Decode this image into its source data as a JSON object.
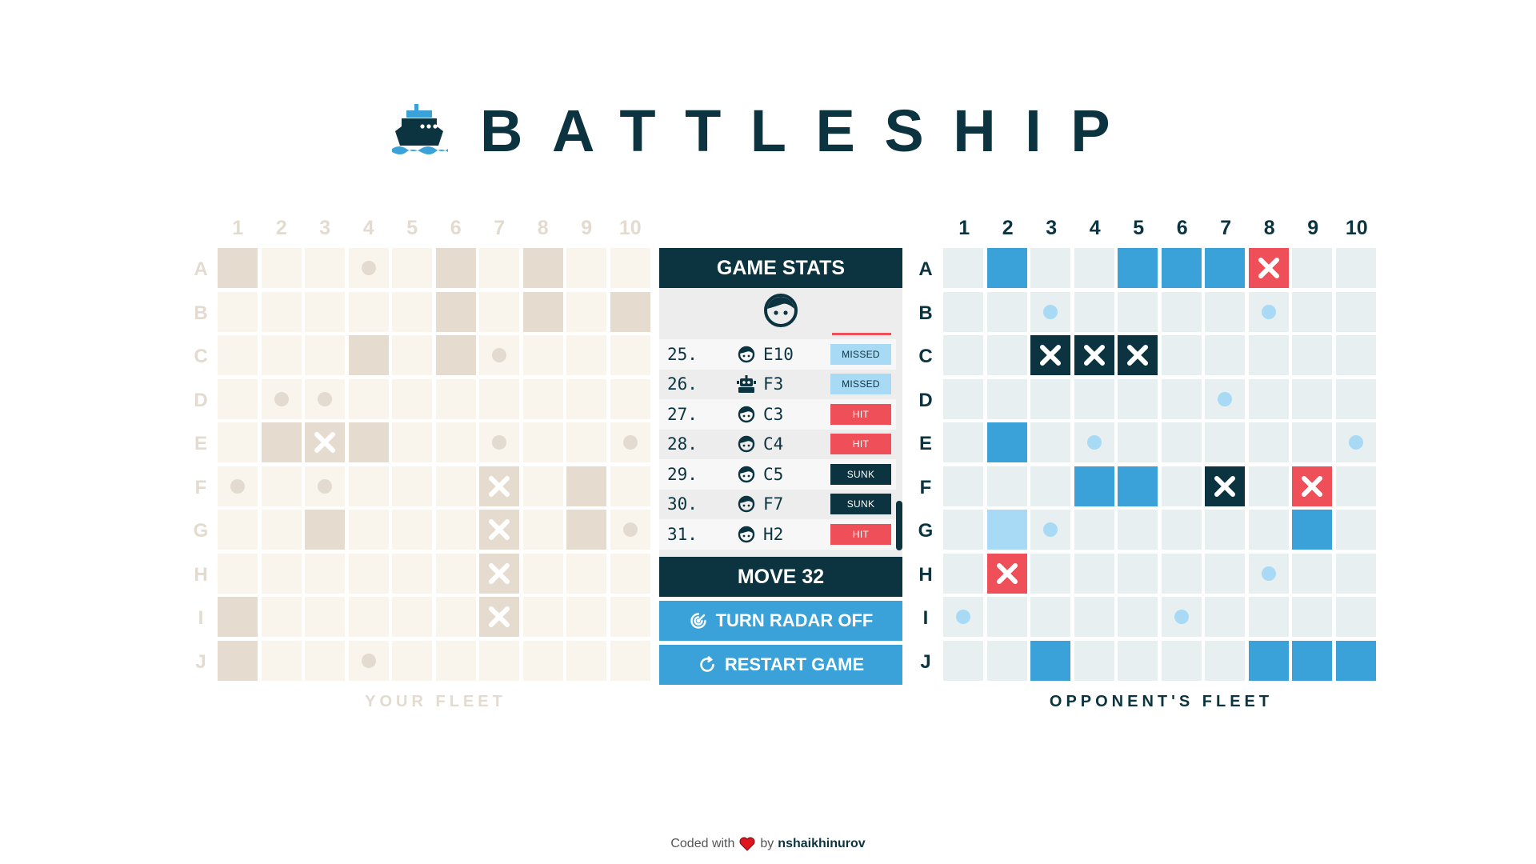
{
  "header": {
    "title": "BATTLESHIP",
    "logo_icon": "ship-icon"
  },
  "columns": [
    "1",
    "2",
    "3",
    "4",
    "5",
    "6",
    "7",
    "8",
    "9",
    "10"
  ],
  "rows": [
    "A",
    "B",
    "C",
    "D",
    "E",
    "F",
    "G",
    "H",
    "I",
    "J"
  ],
  "player_board": {
    "caption": "YOUR FLEET",
    "ship_cells": [
      "A1",
      "A6",
      "A8",
      "B6",
      "B8",
      "B10",
      "C4",
      "C6",
      "E2",
      "E3",
      "E4",
      "F9",
      "G3",
      "G9",
      "I1",
      "J1",
      "F7",
      "G7",
      "H7",
      "I7"
    ],
    "hit_cells": [
      "E3",
      "F7",
      "G7",
      "H7",
      "I7"
    ],
    "miss_cells": [
      "A4",
      "C7",
      "D2",
      "D3",
      "E7",
      "E10",
      "F1",
      "F3",
      "G10",
      "J4"
    ]
  },
  "opponent_board": {
    "caption": "OPPONENT'S FLEET",
    "ship_cells": [
      "A2",
      "A5",
      "A6",
      "A7",
      "E2",
      "F4",
      "F5",
      "G9",
      "J3",
      "J8",
      "J9",
      "J10"
    ],
    "ship_light_cells": [
      "G2"
    ],
    "hit_cells": [
      "A8",
      "F9",
      "H2"
    ],
    "sunk_cells": [
      "C3",
      "C4",
      "C5",
      "F7"
    ],
    "miss_cells": [
      "B3",
      "B8",
      "D7",
      "E4",
      "E10",
      "G3",
      "H8",
      "I1",
      "I6"
    ]
  },
  "panel": {
    "title": "GAME STATS",
    "avatar_icon": "player-face-icon",
    "move_label": "MOVE 32",
    "log": [
      {
        "num": "25.",
        "player": "player",
        "coord": "E10",
        "result": "MISSED",
        "kind": "missed"
      },
      {
        "num": "26.",
        "player": "robot",
        "coord": "F3",
        "result": "MISSED",
        "kind": "missed"
      },
      {
        "num": "27.",
        "player": "player",
        "coord": "C3",
        "result": "HIT",
        "kind": "hit"
      },
      {
        "num": "28.",
        "player": "player",
        "coord": "C4",
        "result": "HIT",
        "kind": "hit"
      },
      {
        "num": "29.",
        "player": "player",
        "coord": "C5",
        "result": "SUNK",
        "kind": "sunk"
      },
      {
        "num": "30.",
        "player": "player",
        "coord": "F7",
        "result": "SUNK",
        "kind": "sunk"
      },
      {
        "num": "31.",
        "player": "player",
        "coord": "H2",
        "result": "HIT",
        "kind": "hit"
      }
    ],
    "radar_button": "TURN RADAR OFF",
    "restart_button": "RESTART GAME"
  },
  "footer": {
    "prefix": "Coded with",
    "by": "by",
    "author": "nshaikhinurov"
  },
  "colors": {
    "navy": "#0b3340",
    "blue": "#3aa1d9",
    "light_blue": "#a8daf6",
    "red": "#ef4f58",
    "beige": "#faf5ec",
    "beige_ship": "#e5dbcf"
  }
}
